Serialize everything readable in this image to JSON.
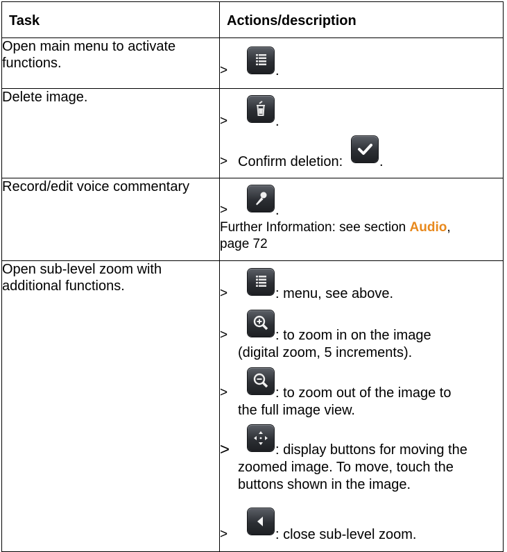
{
  "table": {
    "header_task": "Task",
    "header_actions": "Actions/description"
  },
  "rows": [
    {
      "task": "Open main menu to activate functions.",
      "steps": [
        {
          "bullet": ">",
          "icon": "menu-icon",
          "text": "."
        }
      ]
    },
    {
      "task": "Delete image.",
      "steps": [
        {
          "bullet": ">",
          "icon": "trash-icon",
          "text": "."
        },
        {
          "bullet": ">",
          "text_before": "Confirm deletion:",
          "icon": "checkmark-icon",
          "text": "."
        }
      ]
    },
    {
      "task": "Record/edit voice commentary",
      "steps": [
        {
          "bullet": ">",
          "icon": "microphone-icon",
          "text": "."
        }
      ],
      "note_prefix": "Further Information: see section ",
      "note_link": "Audio",
      "note_suffix": ",",
      "note_line2": "page 72"
    },
    {
      "task": "Open sub-level zoom with additional functions.",
      "steps": [
        {
          "bullet": ">",
          "icon": "menu-icon",
          "text": ": menu, see above."
        },
        {
          "bullet": ">",
          "icon": "zoom-in-icon",
          "line1": ": to zoom in on the image",
          "line2": "(digital zoom, 5 increments)."
        },
        {
          "bullet": ">",
          "icon": "zoom-out-icon",
          "line1": ": to zoom out of the image to",
          "line2": "the full image view."
        },
        {
          "bullet": ">",
          "icon": "move-icon",
          "line1": ": display buttons for moving the",
          "line2": "zoomed image. To move, touch the",
          "line3": "buttons shown in the image."
        },
        {
          "bullet": ">",
          "icon": "back-arrow-icon",
          "text": ": close sub-level zoom."
        }
      ]
    }
  ]
}
